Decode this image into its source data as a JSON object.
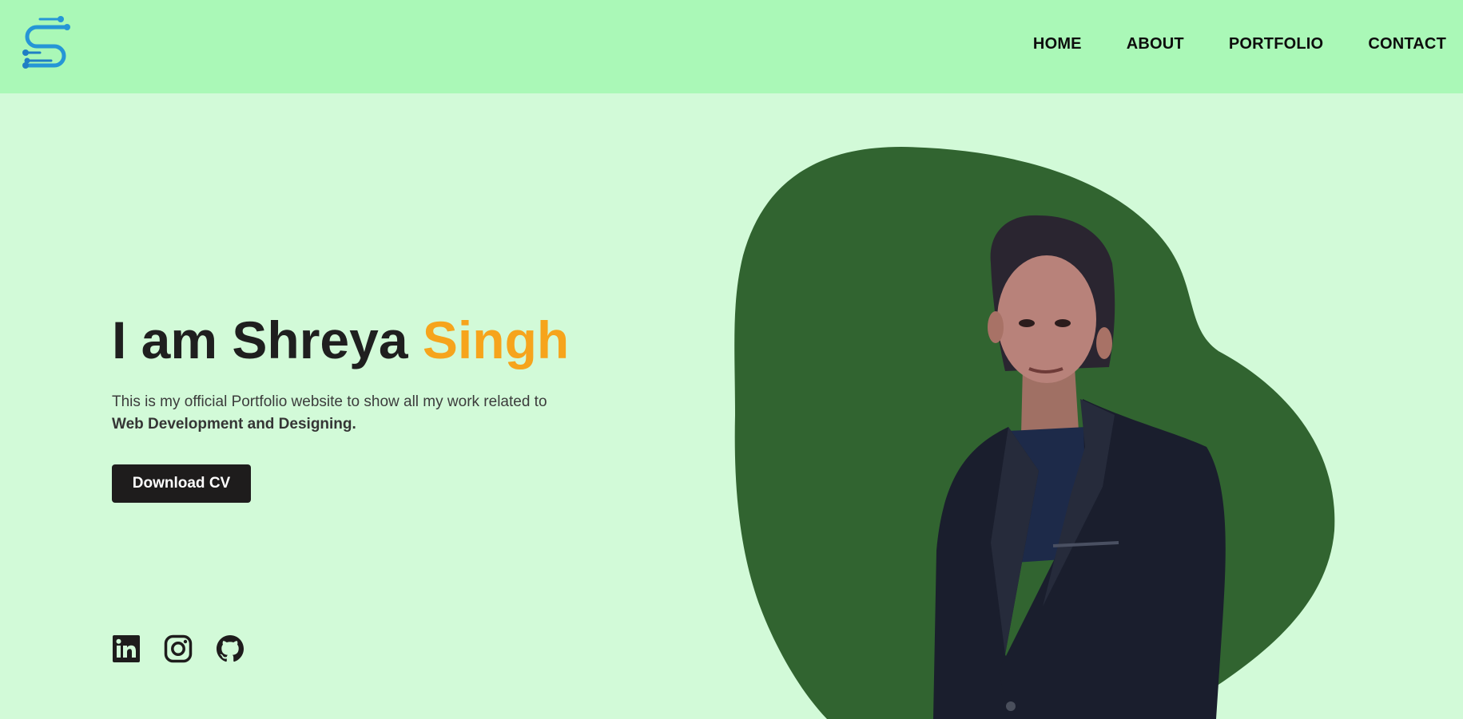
{
  "nav": {
    "links": [
      "HOME",
      "ABOUT",
      "PORTFOLIO",
      "CONTACT"
    ]
  },
  "hero": {
    "title_main": "I am Shreya ",
    "title_accent": "Singh",
    "description_plain": "This is my official Portfolio website to show all my work related to",
    "description_bold": "Web Development and Designing.",
    "cta_label": "Download CV"
  },
  "socials": {
    "icons": [
      "linkedin-icon",
      "instagram-icon",
      "github-icon"
    ]
  },
  "colors": {
    "header_bg": "#aaf8b7",
    "page_bg": "#d2fad8",
    "accent": "#f6a41c",
    "blob": "#316430",
    "button_bg": "#1e1c1c",
    "logo": "#2596d6"
  }
}
